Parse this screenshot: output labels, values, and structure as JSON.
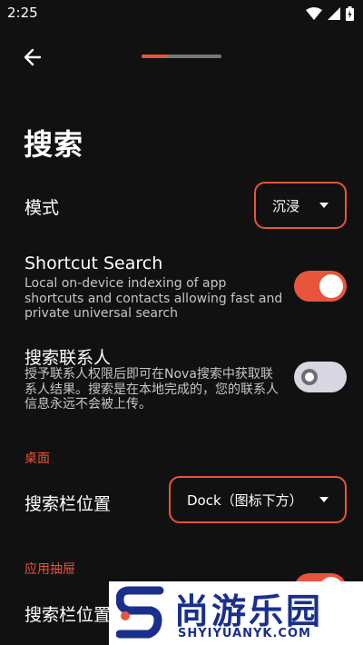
{
  "status_bar": {
    "time": "2:25"
  },
  "header": {
    "progress_fraction": 0.32
  },
  "page": {
    "title": "搜索"
  },
  "mode": {
    "label": "模式",
    "value": "沉浸"
  },
  "shortcut_search": {
    "label": "Shortcut Search",
    "description": "Local on-device indexing of app shortcuts and contacts allowing fast and private universal search",
    "enabled": true
  },
  "contacts": {
    "label": "搜索联系人",
    "description": "授予联系人权限后即可在Nova搜索中获取联系人结果。搜索是在本地完成的，您的联系人信息永远不会被上传。",
    "enabled": false
  },
  "desktop_section": {
    "header": "桌面",
    "search_bar_label": "搜索栏位置",
    "search_bar_value": "Dock（图标下方）"
  },
  "drawer_section": {
    "header": "应用抽屉",
    "search_bar_label": "搜索栏位置"
  },
  "watermark": {
    "title": "尚游乐园",
    "url": "SHYIYUANYK.COM"
  },
  "colors": {
    "accent": "#e8553c",
    "background": "#111111",
    "watermark_blue": "#1a2f8c"
  }
}
